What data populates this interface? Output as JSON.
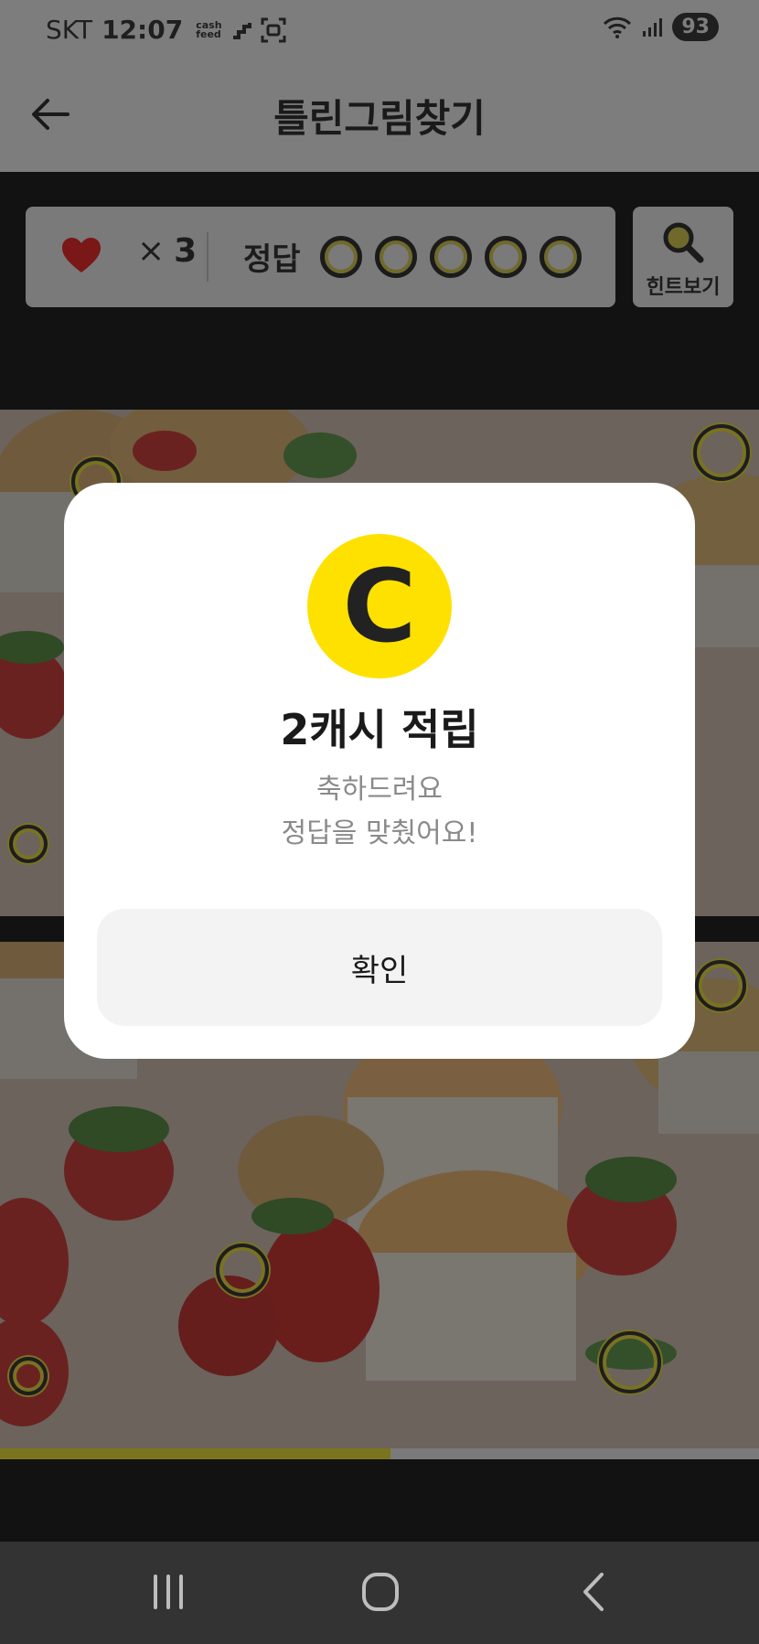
{
  "status_bar": {
    "carrier": "SKT",
    "time": "12:07",
    "cashfeed_top": "cash",
    "cashfeed_bottom": "feed",
    "battery": "93"
  },
  "header": {
    "title": "틀린그림찾기"
  },
  "game": {
    "lives_symbol": "×",
    "lives": "3",
    "answer_label": "정답",
    "answers_total": 5,
    "hint_label": "힌트보기",
    "progress_fraction": 0.515
  },
  "dialog": {
    "coin_letter": "C",
    "title": "2캐시 적립",
    "message_line1": "축하드려요",
    "message_line2": "정답을 맞췄어요!",
    "confirm_label": "확인"
  },
  "colors": {
    "accent_yellow": "#ffe100",
    "heart_red": "#7a1717",
    "dim_gray": "#7d7d7d"
  },
  "icons": [
    "back-arrow-icon",
    "heart-icon",
    "search-icon",
    "recent-apps-icon",
    "home-icon",
    "nav-back-icon"
  ]
}
